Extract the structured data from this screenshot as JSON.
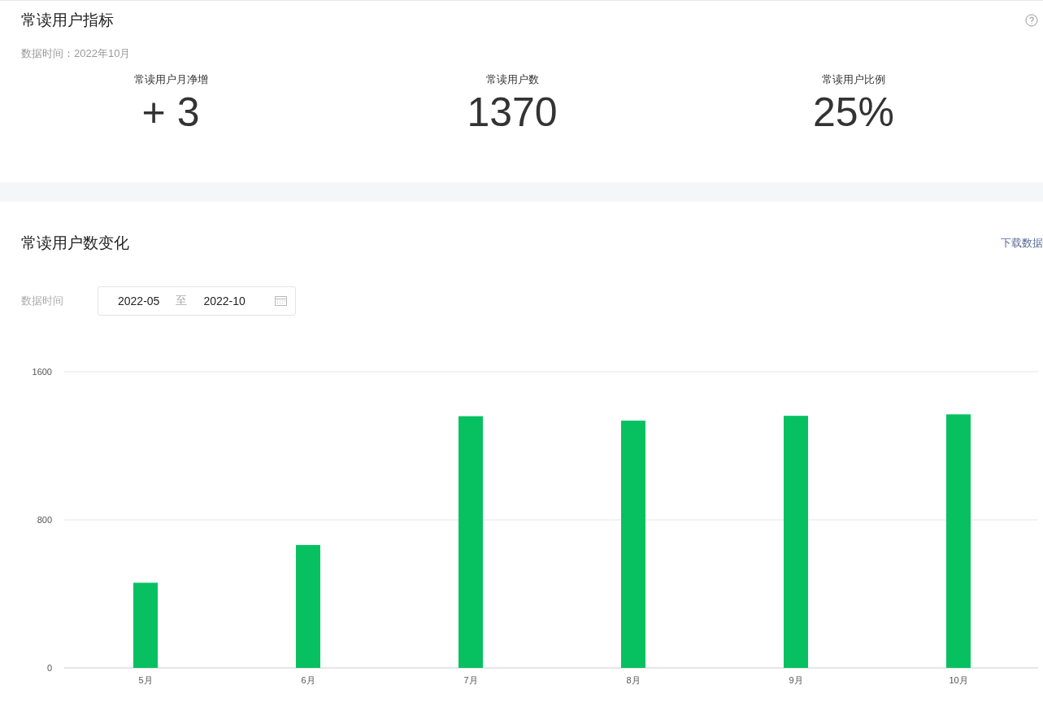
{
  "indicators": {
    "title": "常读用户指标",
    "data_time": "数据时间：2022年10月",
    "metrics": [
      {
        "label": "常读用户月净增",
        "value": "+ 3"
      },
      {
        "label": "常读用户数",
        "value": "1370"
      },
      {
        "label": "常读用户比例",
        "value": "25%"
      }
    ]
  },
  "trend": {
    "title": "常读用户数变化",
    "download_link": "下载数据",
    "filter_label": "数据时间",
    "date_range": {
      "start": "2022-05",
      "separator": "至",
      "end": "2022-10"
    },
    "chart_data": {
      "type": "bar",
      "categories": [
        "5月",
        "6月",
        "7月",
        "8月",
        "9月",
        "10月"
      ],
      "series": [
        {
          "color": "#07c160",
          "values": [
            460,
            664,
            1360,
            1336,
            1362,
            1370
          ]
        }
      ],
      "ylim": [
        0,
        1600
      ],
      "yticks": [
        0,
        800,
        1600
      ]
    }
  }
}
